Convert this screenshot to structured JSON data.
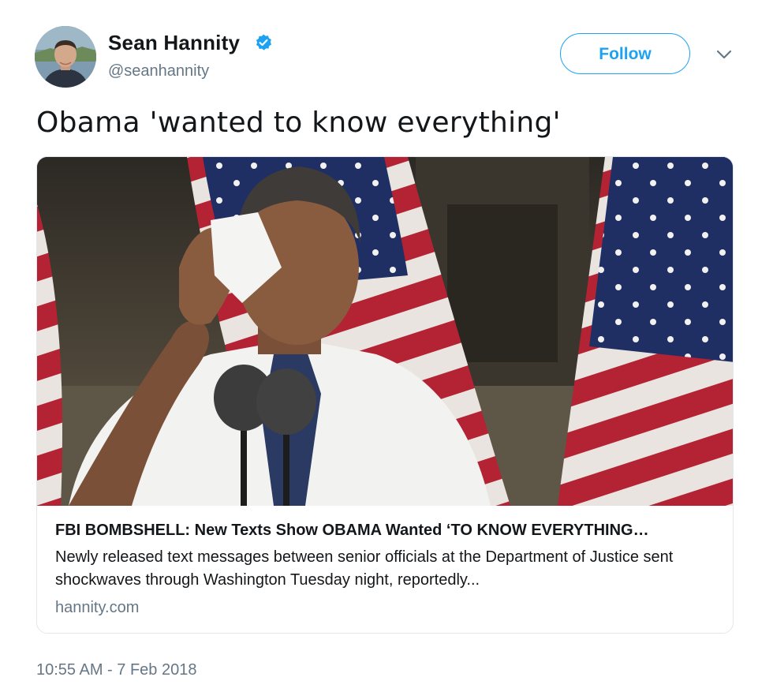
{
  "author": {
    "name": "Sean Hannity",
    "handle": "@seanhannity",
    "verified": true,
    "verified_icon": "verified-badge-icon",
    "avatar_icon": "avatar-photo"
  },
  "follow_button": {
    "label": "Follow"
  },
  "more_menu": {
    "icon": "chevron-down-icon"
  },
  "tweet": {
    "text": "Obama 'wanted to know everything'",
    "timestamp": "10:55 AM - 7 Feb 2018"
  },
  "card": {
    "title": "FBI BOMBSHELL: New Texts Show OBAMA Wanted ‘TO KNOW EVERYTHING…",
    "description": "Newly released text messages between senior officials at the Department of Justice sent shockwaves through Washington Tuesday night, reportedly...",
    "domain": "hannity.com"
  },
  "colors": {
    "accent": "#1da1f2",
    "text_primary": "#14171a",
    "text_secondary": "#657786",
    "border": "#e1e8ed"
  }
}
